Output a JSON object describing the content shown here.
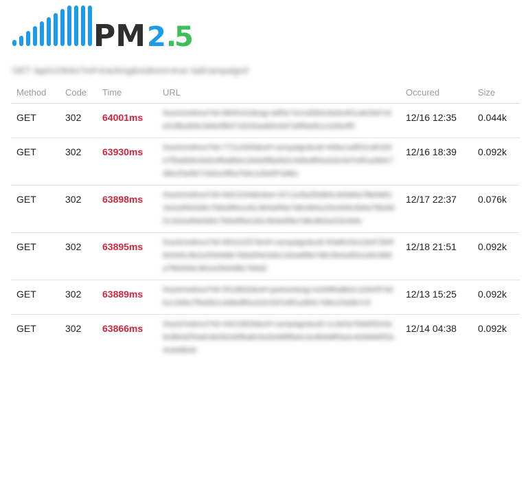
{
  "logo": {
    "text_pm": "PM",
    "text_version": "2.5",
    "bar_color": "#1e9be6",
    "pm_color": "#2f2f2f",
    "version_blue": "#1e9be6",
    "version_green": "#3fbf5a"
  },
  "subtitle": "GET /api/v1/links?ref=tracking&redirect=true /ad/campaign/links",
  "table": {
    "headers": {
      "method": "Method",
      "code": "Code",
      "time": "Time",
      "url": "URL",
      "occured": "Occured",
      "size": "Size"
    },
    "rows": [
      {
        "method": "GET",
        "code": "302",
        "time": "64001ms",
        "url": "/track/redirect?id=8845102&sig=a9f3c7e21d0b5c8a0e4f11ab29d7c6e01f8a2b9c3d4e5f60718293a4b5c6d7e8f9a0b1c2d3e4f5",
        "occured": "12/16 12:35",
        "size": "0.044k"
      },
      {
        "method": "GET",
        "code": "302",
        "time": "63930ms",
        "url": "/track/redirect?id=77214309&ref=campaign&uid=40be1a9f22cd0183e7f5a6b9c0d2e4f6a8b0c2d4e6f8a0b2c4d6e8f0a1b3c5d7e9f1a3b5c7d9e1f3a5b7c9d1e3f5a7b9c1d3e5f7a9b1",
        "occured": "12/16 18:39",
        "size": "0.092k"
      },
      {
        "method": "GET",
        "code": "302",
        "time": "63898ms",
        "url": "/track/redirect?id=9921044&token=b7c1e9a2f0d84c3e5b6a7f8e9d0c1b2a3f4e5d6c7b8a9f0e1d2c3b4a5f6e7d8c9b0a1f2e3d4c5b6a7f8e9d0c1b2a3f4e5d6c7b8a9f0e1d2c3b4a5f6e7d8c9b0a1f2e3d4c",
        "occured": "12/17 22:37",
        "size": "0.076k"
      },
      {
        "method": "GET",
        "code": "302",
        "time": "63895ms",
        "url": "/track/redirect?id=66310257&ref=campaign&uid=93af0c5e11bd7284f6e5d4c3b2a1f0e9d8c7b6a5f4e3d2c1b0a9f8e7d6c5b4a3f2e1d0c9b8a7f6e5d4c3b2a1f0e9d8c7b6a5",
        "occured": "12/18 21:51",
        "size": "0.092k"
      },
      {
        "method": "GET",
        "code": "302",
        "time": "63889ms",
        "url": "/track/redirect?id=5518830&ref=partner&sig=e2d4f6a8b0c1d3e5f7a9b1c3d5e7f9a0b2c4d6e8f0a1b3c5d7e9f1a3b5c7d9e1f3a5b7c9",
        "occured": "12/13 15:25",
        "size": "0.092k"
      },
      {
        "method": "GET",
        "code": "302",
        "time": "63866ms",
        "url": "/track/redirect?id=44019826&ref=campaign&uid=1c3e5a7b9d0f2e4a6c8b0d2f4a6c8e0b2d4f6a8c0e2b4d6f8a0c2e4b6d8f0a2c4e6b8d0f2a4c6e8b0d",
        "occured": "12/14 04:38",
        "size": "0.092k"
      }
    ]
  }
}
